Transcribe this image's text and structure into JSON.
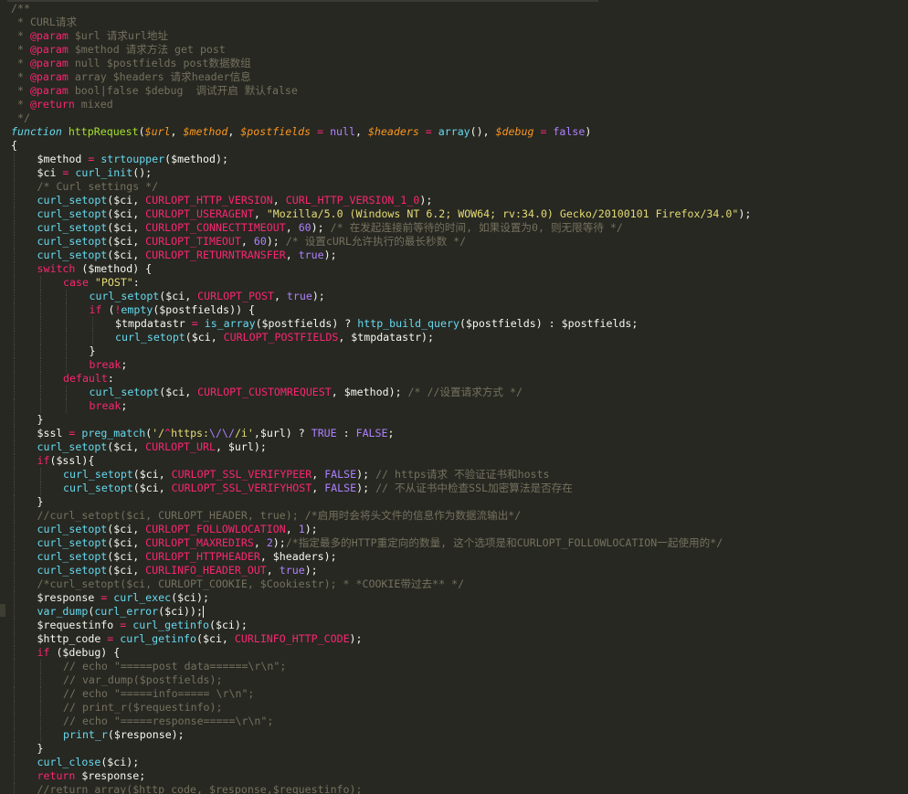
{
  "editor": {
    "language": "php",
    "theme": "monokai",
    "colors": {
      "background": "#272822",
      "comment": "#75715e",
      "keyword": "#f92672",
      "string": "#e6db74",
      "function": "#66d9ef",
      "constant": "#a6e22e",
      "number": "#ae81ff",
      "variable": "#fd971f",
      "plain": "#f8f8f2"
    },
    "cursor_line": 44,
    "lines": [
      {
        "indent": 0,
        "tokens": [
          [
            "cm",
            "/**"
          ]
        ]
      },
      {
        "indent": 0,
        "tokens": [
          [
            "cm",
            " * CURL请求"
          ]
        ]
      },
      {
        "indent": 0,
        "tokens": [
          [
            "cm",
            " * "
          ],
          [
            "kw",
            "@param"
          ],
          [
            "cm",
            " $url 请求url地址"
          ]
        ]
      },
      {
        "indent": 0,
        "tokens": [
          [
            "cm",
            " * "
          ],
          [
            "kw",
            "@param"
          ],
          [
            "cm",
            " $method 请求方法 get post"
          ]
        ]
      },
      {
        "indent": 0,
        "tokens": [
          [
            "cm",
            " * "
          ],
          [
            "kw",
            "@param"
          ],
          [
            "cm",
            " null $postfields post数据数组"
          ]
        ]
      },
      {
        "indent": 0,
        "tokens": [
          [
            "cm",
            " * "
          ],
          [
            "kw",
            "@param"
          ],
          [
            "cm",
            " array $headers 请求header信息"
          ]
        ]
      },
      {
        "indent": 0,
        "tokens": [
          [
            "cm",
            " * "
          ],
          [
            "kw",
            "@param"
          ],
          [
            "cm",
            " bool|false $debug  调试开启 默认false"
          ]
        ]
      },
      {
        "indent": 0,
        "tokens": [
          [
            "cm",
            " * "
          ],
          [
            "kw",
            "@return"
          ],
          [
            "cm",
            " mixed"
          ]
        ]
      },
      {
        "indent": 0,
        "tokens": [
          [
            "cm",
            " */"
          ]
        ]
      },
      {
        "indent": 0,
        "tokens": [
          [
            "fv",
            "function"
          ],
          [
            "pl",
            " "
          ],
          [
            "ds",
            "httpRequest"
          ],
          [
            "pl",
            "("
          ],
          [
            "pi",
            "$url"
          ],
          [
            "pl",
            ", "
          ],
          [
            "pi",
            "$method"
          ],
          [
            "pl",
            ", "
          ],
          [
            "pi",
            "$postfields"
          ],
          [
            "pl",
            " "
          ],
          [
            "kw",
            "="
          ],
          [
            "pl",
            " "
          ],
          [
            "nu",
            "null"
          ],
          [
            "pl",
            ", "
          ],
          [
            "pi",
            "$headers"
          ],
          [
            "pl",
            " "
          ],
          [
            "kw",
            "="
          ],
          [
            "pl",
            " "
          ],
          [
            "fn",
            "array"
          ],
          [
            "pl",
            "(), "
          ],
          [
            "pi",
            "$debug"
          ],
          [
            "pl",
            " "
          ],
          [
            "kw",
            "="
          ],
          [
            "pl",
            " "
          ],
          [
            "nu",
            "false"
          ],
          [
            "pl",
            ")"
          ]
        ]
      },
      {
        "indent": 0,
        "tokens": [
          [
            "pl",
            "{"
          ]
        ]
      },
      {
        "indent": 1,
        "tokens": [
          [
            "pl",
            "$method "
          ],
          [
            "kw",
            "="
          ],
          [
            "pl",
            " "
          ],
          [
            "fn",
            "strtoupper"
          ],
          [
            "pl",
            "($method);"
          ]
        ]
      },
      {
        "indent": 1,
        "tokens": [
          [
            "pl",
            "$ci "
          ],
          [
            "kw",
            "="
          ],
          [
            "pl",
            " "
          ],
          [
            "fn",
            "curl_init"
          ],
          [
            "pl",
            "();"
          ]
        ]
      },
      {
        "indent": 1,
        "tokens": [
          [
            "cm",
            "/* Curl settings */"
          ]
        ]
      },
      {
        "indent": 1,
        "tokens": [
          [
            "fn",
            "curl_setopt"
          ],
          [
            "pl",
            "($ci, "
          ],
          [
            "kw",
            "CURLOPT_HTTP_VERSION"
          ],
          [
            "pl",
            ", "
          ],
          [
            "kw",
            "CURL_HTTP_VERSION_1_0"
          ],
          [
            "pl",
            ");"
          ]
        ]
      },
      {
        "indent": 1,
        "tokens": [
          [
            "fn",
            "curl_setopt"
          ],
          [
            "pl",
            "($ci, "
          ],
          [
            "kw",
            "CURLOPT_USERAGENT"
          ],
          [
            "pl",
            ", "
          ],
          [
            "st",
            "\"Mozilla/5.0 (Windows NT 6.2; WOW64; rv:34.0) Gecko/20100101 Firefox/34.0\""
          ],
          [
            "pl",
            ");"
          ]
        ]
      },
      {
        "indent": 1,
        "tokens": [
          [
            "fn",
            "curl_setopt"
          ],
          [
            "pl",
            "($ci, "
          ],
          [
            "kw",
            "CURLOPT_CONNECTTIMEOUT"
          ],
          [
            "pl",
            ", "
          ],
          [
            "nu",
            "60"
          ],
          [
            "pl",
            "); "
          ],
          [
            "cm",
            "/* 在发起连接前等待的时间, 如果设置为0, 则无限等待 */"
          ]
        ]
      },
      {
        "indent": 1,
        "tokens": [
          [
            "fn",
            "curl_setopt"
          ],
          [
            "pl",
            "($ci, "
          ],
          [
            "kw",
            "CURLOPT_TIMEOUT"
          ],
          [
            "pl",
            ", "
          ],
          [
            "nu",
            "60"
          ],
          [
            "pl",
            "); "
          ],
          [
            "cm",
            "/* 设置cURL允许执行的最长秒数 */"
          ]
        ]
      },
      {
        "indent": 1,
        "tokens": [
          [
            "fn",
            "curl_setopt"
          ],
          [
            "pl",
            "($ci, "
          ],
          [
            "kw",
            "CURLOPT_RETURNTRANSFER"
          ],
          [
            "pl",
            ", "
          ],
          [
            "nu",
            "true"
          ],
          [
            "pl",
            ");"
          ]
        ]
      },
      {
        "indent": 1,
        "tokens": [
          [
            "kw",
            "switch"
          ],
          [
            "pl",
            " ($method) {"
          ]
        ]
      },
      {
        "indent": 2,
        "tokens": [
          [
            "kw",
            "case"
          ],
          [
            "pl",
            " "
          ],
          [
            "st",
            "\"POST\""
          ],
          [
            "pl",
            ":"
          ]
        ]
      },
      {
        "indent": 3,
        "tokens": [
          [
            "fn",
            "curl_setopt"
          ],
          [
            "pl",
            "($ci, "
          ],
          [
            "kw",
            "CURLOPT_POST"
          ],
          [
            "pl",
            ", "
          ],
          [
            "nu",
            "true"
          ],
          [
            "pl",
            ");"
          ]
        ]
      },
      {
        "indent": 3,
        "tokens": [
          [
            "kw",
            "if"
          ],
          [
            "pl",
            " ("
          ],
          [
            "kw",
            "!"
          ],
          [
            "fn",
            "empty"
          ],
          [
            "pl",
            "($postfields)) {"
          ]
        ]
      },
      {
        "indent": 4,
        "tokens": [
          [
            "pl",
            "$tmpdatastr "
          ],
          [
            "kw",
            "="
          ],
          [
            "pl",
            " "
          ],
          [
            "fn",
            "is_array"
          ],
          [
            "pl",
            "($postfields) ? "
          ],
          [
            "fn",
            "http_build_query"
          ],
          [
            "pl",
            "($postfields) : $postfields;"
          ]
        ]
      },
      {
        "indent": 4,
        "tokens": [
          [
            "fn",
            "curl_setopt"
          ],
          [
            "pl",
            "($ci, "
          ],
          [
            "kw",
            "CURLOPT_POSTFIELDS"
          ],
          [
            "pl",
            ", $tmpdatastr);"
          ]
        ]
      },
      {
        "indent": 3,
        "tokens": [
          [
            "pl",
            "}"
          ]
        ]
      },
      {
        "indent": 3,
        "tokens": [
          [
            "kw",
            "break"
          ],
          [
            "pl",
            ";"
          ]
        ]
      },
      {
        "indent": 2,
        "tokens": [
          [
            "kw",
            "default"
          ],
          [
            "pl",
            ":"
          ]
        ]
      },
      {
        "indent": 3,
        "tokens": [
          [
            "fn",
            "curl_setopt"
          ],
          [
            "pl",
            "($ci, "
          ],
          [
            "kw",
            "CURLOPT_CUSTOMREQUEST"
          ],
          [
            "pl",
            ", $method); "
          ],
          [
            "cm",
            "/* //设置请求方式 */"
          ]
        ]
      },
      {
        "indent": 3,
        "tokens": [
          [
            "kw",
            "break"
          ],
          [
            "pl",
            ";"
          ]
        ]
      },
      {
        "indent": 1,
        "tokens": [
          [
            "pl",
            "}"
          ]
        ]
      },
      {
        "indent": 1,
        "tokens": [
          [
            "pl",
            "$ssl "
          ],
          [
            "kw",
            "="
          ],
          [
            "pl",
            " "
          ],
          [
            "fn",
            "preg_match"
          ],
          [
            "pl",
            "("
          ],
          [
            "st",
            "'/"
          ],
          [
            "kw",
            "^"
          ],
          [
            "st",
            "https:"
          ],
          [
            "wi",
            "\\/\\/"
          ],
          [
            "st",
            "/i'"
          ],
          [
            "pl",
            ",$url) ? "
          ],
          [
            "nu",
            "TRUE"
          ],
          [
            "pl",
            " : "
          ],
          [
            "nu",
            "FALSE"
          ],
          [
            "pl",
            ";"
          ]
        ]
      },
      {
        "indent": 1,
        "tokens": [
          [
            "fn",
            "curl_setopt"
          ],
          [
            "pl",
            "($ci, "
          ],
          [
            "kw",
            "CURLOPT_URL"
          ],
          [
            "pl",
            ", $url);"
          ]
        ]
      },
      {
        "indent": 1,
        "tokens": [
          [
            "kw",
            "if"
          ],
          [
            "pl",
            "($ssl){"
          ]
        ]
      },
      {
        "indent": 2,
        "tokens": [
          [
            "fn",
            "curl_setopt"
          ],
          [
            "pl",
            "($ci, "
          ],
          [
            "kw",
            "CURLOPT_SSL_VERIFYPEER"
          ],
          [
            "pl",
            ", "
          ],
          [
            "nu",
            "FALSE"
          ],
          [
            "pl",
            "); "
          ],
          [
            "cm",
            "// https请求 不验证证书和hosts"
          ]
        ]
      },
      {
        "indent": 2,
        "tokens": [
          [
            "fn",
            "curl_setopt"
          ],
          [
            "pl",
            "($ci, "
          ],
          [
            "kw",
            "CURLOPT_SSL_VERIFYHOST"
          ],
          [
            "pl",
            ", "
          ],
          [
            "nu",
            "FALSE"
          ],
          [
            "pl",
            "); "
          ],
          [
            "cm",
            "// 不从证书中检查SSL加密算法是否存在"
          ]
        ]
      },
      {
        "indent": 1,
        "tokens": [
          [
            "pl",
            "}"
          ]
        ]
      },
      {
        "indent": 1,
        "tokens": [
          [
            "cm",
            "//curl_setopt($ci, CURLOPT_HEADER, true); /*启用时会将头文件的信息作为数据流输出*/"
          ]
        ]
      },
      {
        "indent": 1,
        "tokens": [
          [
            "fn",
            "curl_setopt"
          ],
          [
            "pl",
            "($ci, "
          ],
          [
            "kw",
            "CURLOPT_FOLLOWLOCATION"
          ],
          [
            "pl",
            ", "
          ],
          [
            "nu",
            "1"
          ],
          [
            "pl",
            ");"
          ]
        ]
      },
      {
        "indent": 1,
        "tokens": [
          [
            "fn",
            "curl_setopt"
          ],
          [
            "pl",
            "($ci, "
          ],
          [
            "kw",
            "CURLOPT_MAXREDIRS"
          ],
          [
            "pl",
            ", "
          ],
          [
            "nu",
            "2"
          ],
          [
            "pl",
            ");"
          ],
          [
            "cm",
            "/*指定最多的HTTP重定向的数量, 这个选项是和CURLOPT_FOLLOWLOCATION一起使用的*/"
          ]
        ]
      },
      {
        "indent": 1,
        "tokens": [
          [
            "fn",
            "curl_setopt"
          ],
          [
            "pl",
            "($ci, "
          ],
          [
            "kw",
            "CURLOPT_HTTPHEADER"
          ],
          [
            "pl",
            ", $headers);"
          ]
        ]
      },
      {
        "indent": 1,
        "tokens": [
          [
            "fn",
            "curl_setopt"
          ],
          [
            "pl",
            "($ci, "
          ],
          [
            "kw",
            "CURLINFO_HEADER_OUT"
          ],
          [
            "pl",
            ", "
          ],
          [
            "nu",
            "true"
          ],
          [
            "pl",
            ");"
          ]
        ]
      },
      {
        "indent": 1,
        "tokens": [
          [
            "cm",
            "/*curl_setopt($ci, CURLOPT_COOKIE, $Cookiestr); * *COOKIE带过去** */"
          ]
        ]
      },
      {
        "indent": 1,
        "tokens": [
          [
            "pl",
            "$response "
          ],
          [
            "kw",
            "="
          ],
          [
            "pl",
            " "
          ],
          [
            "fn",
            "curl_exec"
          ],
          [
            "pl",
            "($ci);"
          ]
        ]
      },
      {
        "indent": 1,
        "tokens": [
          [
            "fn",
            "var_dump"
          ],
          [
            "pl",
            "("
          ],
          [
            "fn",
            "curl_error"
          ],
          [
            "pl",
            "($ci));"
          ]
        ]
      },
      {
        "indent": 1,
        "tokens": [
          [
            "pl",
            "$requestinfo "
          ],
          [
            "kw",
            "="
          ],
          [
            "pl",
            " "
          ],
          [
            "fn",
            "curl_getinfo"
          ],
          [
            "pl",
            "($ci);"
          ]
        ]
      },
      {
        "indent": 1,
        "tokens": [
          [
            "pl",
            "$http_code "
          ],
          [
            "kw",
            "="
          ],
          [
            "pl",
            " "
          ],
          [
            "fn",
            "curl_getinfo"
          ],
          [
            "pl",
            "($ci, "
          ],
          [
            "kw",
            "CURLINFO_HTTP_CODE"
          ],
          [
            "pl",
            ");"
          ]
        ]
      },
      {
        "indent": 1,
        "tokens": [
          [
            "kw",
            "if"
          ],
          [
            "pl",
            " ($debug) {"
          ]
        ]
      },
      {
        "indent": 2,
        "tokens": [
          [
            "cm",
            "// echo \"=====post data======\\r\\n\";"
          ]
        ]
      },
      {
        "indent": 2,
        "tokens": [
          [
            "cm",
            "// var_dump($postfields);"
          ]
        ]
      },
      {
        "indent": 2,
        "tokens": [
          [
            "cm",
            "// echo \"=====info===== \\r\\n\";"
          ]
        ]
      },
      {
        "indent": 2,
        "tokens": [
          [
            "cm",
            "// print_r($requestinfo);"
          ]
        ]
      },
      {
        "indent": 2,
        "tokens": [
          [
            "cm",
            "// echo \"=====response=====\\r\\n\";"
          ]
        ]
      },
      {
        "indent": 2,
        "tokens": [
          [
            "fn",
            "print_r"
          ],
          [
            "pl",
            "($response);"
          ]
        ]
      },
      {
        "indent": 1,
        "tokens": [
          [
            "pl",
            "}"
          ]
        ]
      },
      {
        "indent": 1,
        "tokens": [
          [
            "fn",
            "curl_close"
          ],
          [
            "pl",
            "($ci);"
          ]
        ]
      },
      {
        "indent": 1,
        "tokens": [
          [
            "kw",
            "return"
          ],
          [
            "pl",
            " $response;"
          ]
        ]
      },
      {
        "indent": 1,
        "tokens": [
          [
            "cm",
            "//return array($http_code, $response,$requestinfo);"
          ]
        ]
      }
    ]
  }
}
